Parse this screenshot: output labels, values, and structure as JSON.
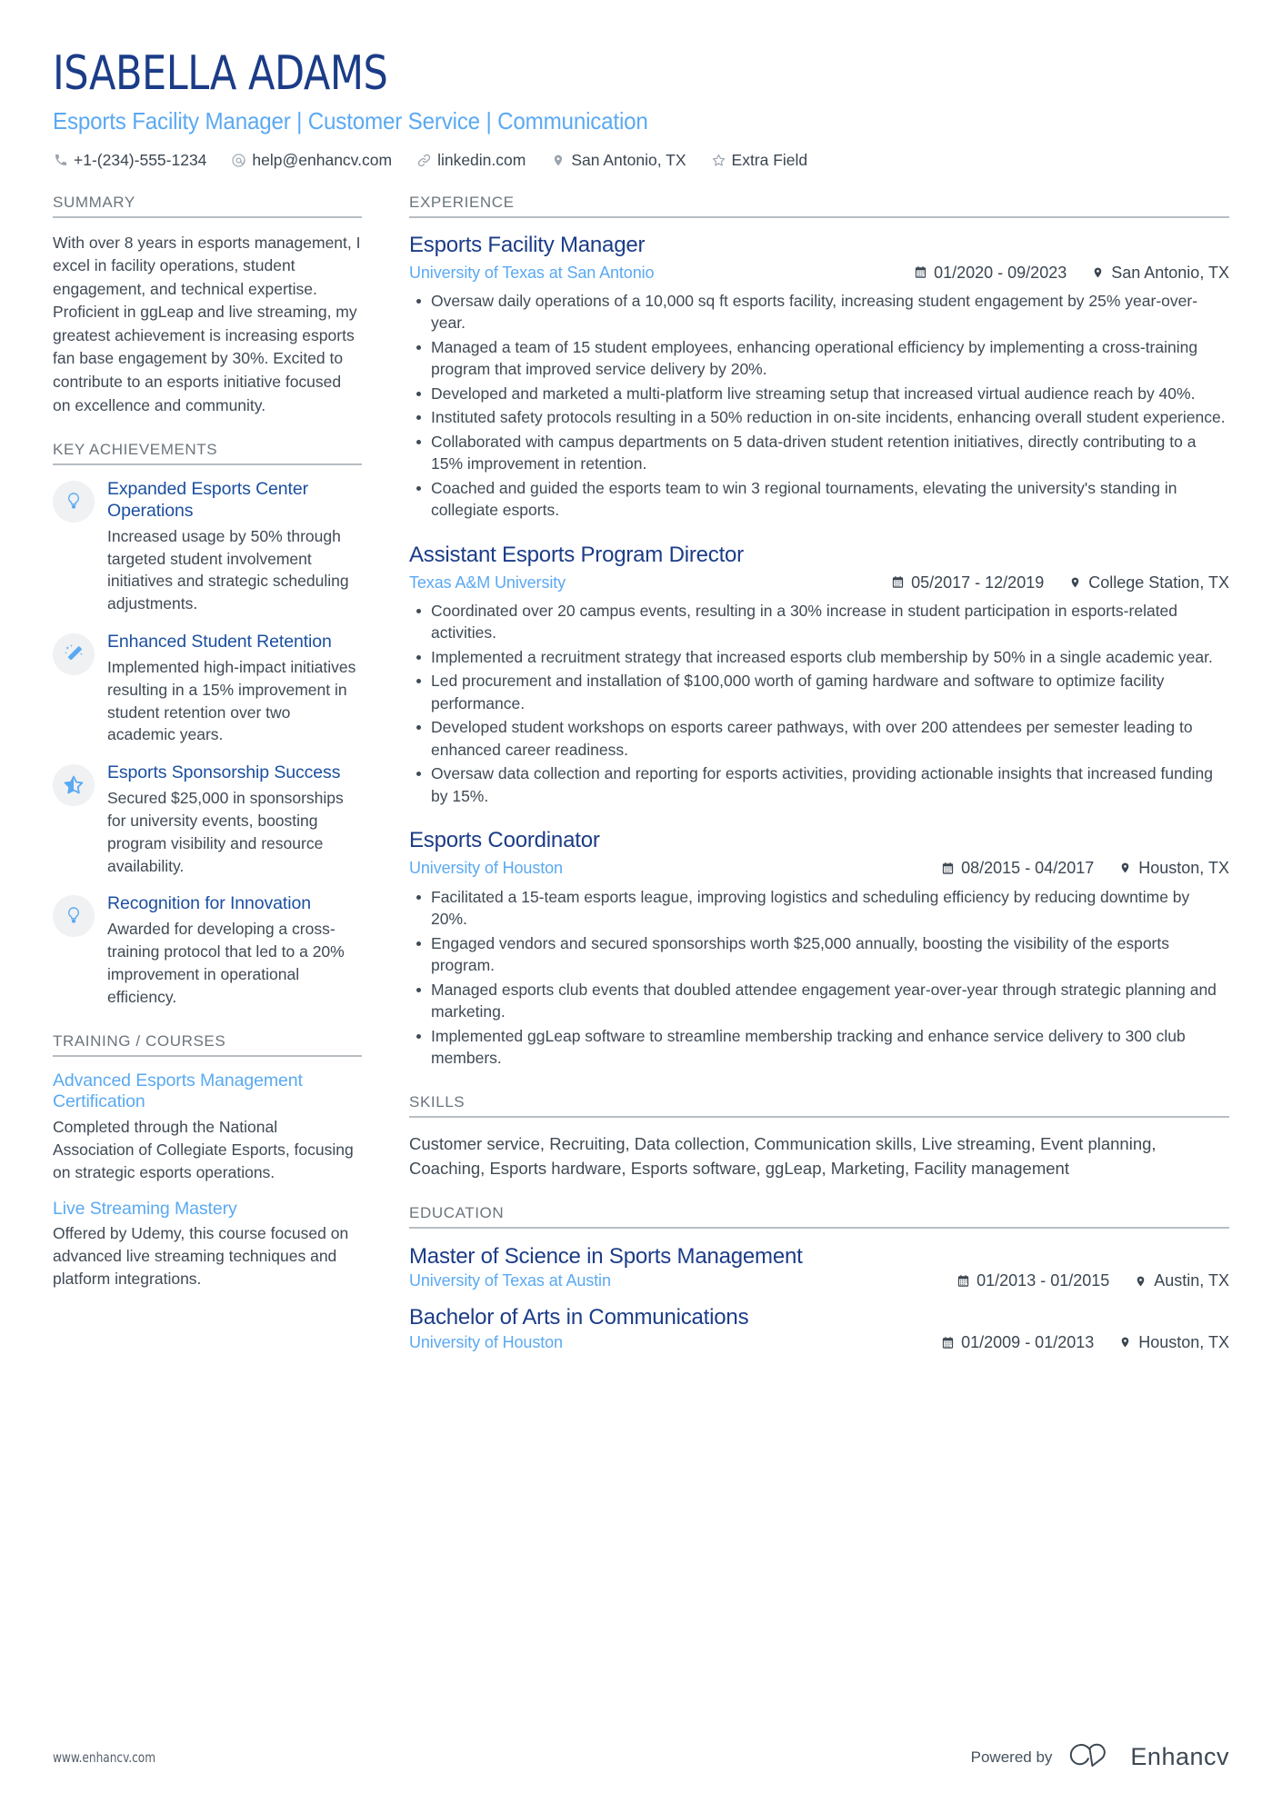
{
  "header": {
    "name": "ISABELLA ADAMS",
    "headline": "Esports Facility Manager | Customer Service | Communication",
    "contacts": [
      {
        "icon": "phone-icon",
        "text": "+1-(234)-555-1234"
      },
      {
        "icon": "email-icon",
        "text": "help@enhancv.com"
      },
      {
        "icon": "link-icon",
        "text": "linkedin.com"
      },
      {
        "icon": "location-pin-icon",
        "text": "San Antonio, TX"
      },
      {
        "icon": "star-icon",
        "text": "Extra Field"
      }
    ]
  },
  "sidebar": {
    "summary": {
      "title": "SUMMARY",
      "text": "With over 8 years in esports management, I excel in facility operations, student engagement, and technical expertise. Proficient in ggLeap and live streaming, my greatest achievement is increasing esports fan base engagement by 30%. Excited to contribute to an esports initiative focused on excellence and community."
    },
    "achievements": {
      "title": "KEY ACHIEVEMENTS",
      "items": [
        {
          "icon": "lightbulb-icon",
          "title": "Expanded Esports Center Operations",
          "desc": "Increased usage by 50% through targeted student involvement initiatives and strategic scheduling adjustments."
        },
        {
          "icon": "magic-wand-icon",
          "title": "Enhanced Student Retention",
          "desc": "Implemented high-impact initiatives resulting in a 15% improvement in student retention over two academic years."
        },
        {
          "icon": "star-badge-icon",
          "title": "Esports Sponsorship Success",
          "desc": "Secured $25,000 in sponsorships for university events, boosting program visibility and resource availability."
        },
        {
          "icon": "lightbulb-icon",
          "title": "Recognition for Innovation",
          "desc": "Awarded for developing a cross-training protocol that led to a 20% improvement in operational efficiency."
        }
      ]
    },
    "training": {
      "title": "TRAINING / COURSES",
      "items": [
        {
          "title": "Advanced Esports Management Certification",
          "desc": "Completed through the National Association of Collegiate Esports, focusing on strategic esports operations."
        },
        {
          "title": "Live Streaming Mastery",
          "desc": "Offered by Udemy, this course focused on advanced live streaming techniques and platform integrations."
        }
      ]
    }
  },
  "main": {
    "experience": {
      "title": "EXPERIENCE",
      "jobs": [
        {
          "title": "Esports Facility Manager",
          "company": "University of Texas at San Antonio",
          "dates": "01/2020 - 09/2023",
          "location": "San Antonio, TX",
          "bullets": [
            "Oversaw daily operations of a 10,000 sq ft esports facility, increasing student engagement by 25% year-over-year.",
            "Managed a team of 15 student employees, enhancing operational efficiency by implementing a cross-training program that improved service delivery by 20%.",
            "Developed and marketed a multi-platform live streaming setup that increased virtual audience reach by 40%.",
            "Instituted safety protocols resulting in a 50% reduction in on-site incidents, enhancing overall student experience.",
            "Collaborated with campus departments on 5 data-driven student retention initiatives, directly contributing to a 15% improvement in retention.",
            "Coached and guided the esports team to win 3 regional tournaments, elevating the university's standing in collegiate esports."
          ]
        },
        {
          "title": "Assistant Esports Program Director",
          "company": "Texas A&M University",
          "dates": "05/2017 - 12/2019",
          "location": "College Station, TX",
          "bullets": [
            "Coordinated over 20 campus events, resulting in a 30% increase in student participation in esports-related activities.",
            "Implemented a recruitment strategy that increased esports club membership by 50% in a single academic year.",
            "Led procurement and installation of $100,000 worth of gaming hardware and software to optimize facility performance.",
            "Developed student workshops on esports career pathways, with over 200 attendees per semester leading to enhanced career readiness.",
            "Oversaw data collection and reporting for esports activities, providing actionable insights that increased funding by 15%."
          ]
        },
        {
          "title": "Esports Coordinator",
          "company": "University of Houston",
          "dates": "08/2015 - 04/2017",
          "location": "Houston, TX",
          "bullets": [
            "Facilitated a 15-team esports league, improving logistics and scheduling efficiency by reducing downtime by 20%.",
            "Engaged vendors and secured sponsorships worth $25,000 annually, boosting the visibility of the esports program.",
            "Managed esports club events that doubled attendee engagement year-over-year through strategic planning and marketing.",
            "Implemented ggLeap software to streamline membership tracking and enhance service delivery to 300 club members."
          ]
        }
      ]
    },
    "skills": {
      "title": "SKILLS",
      "text": "Customer service, Recruiting, Data collection, Communication skills, Live streaming, Event planning, Coaching, Esports hardware, Esports software, ggLeap, Marketing, Facility management"
    },
    "education": {
      "title": "EDUCATION",
      "items": [
        {
          "degree": "Master of Science in Sports Management",
          "school": "University of Texas at Austin",
          "dates": "01/2013 - 01/2015",
          "location": "Austin, TX"
        },
        {
          "degree": "Bachelor of Arts in Communications",
          "school": "University of Houston",
          "dates": "01/2009 - 01/2013",
          "location": "Houston, TX"
        }
      ]
    }
  },
  "footer": {
    "url": "www.enhancv.com",
    "powered_by": "Powered by",
    "brand": "Enhancv"
  },
  "colors": {
    "name_navy": "#1b3c87",
    "accent_blue": "#5aa9f2",
    "heading_gray": "#6c757d",
    "body_gray": "#404a55",
    "rule_gray": "#b7bdc3"
  }
}
